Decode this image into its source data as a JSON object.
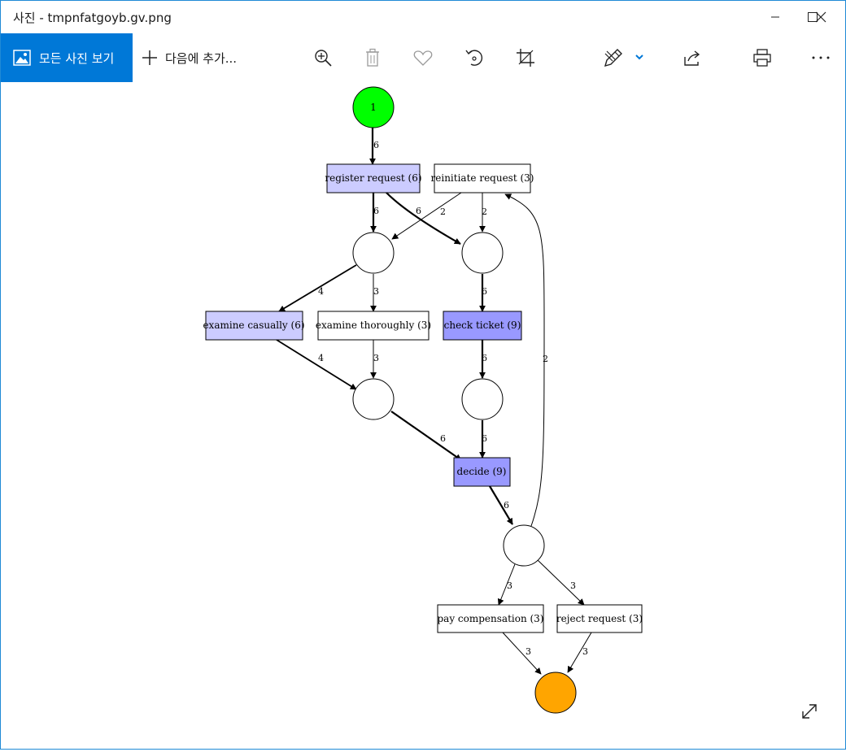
{
  "window": {
    "title": "사진 - tmpnfatgoyb.gv.png",
    "minimize_icon": "minimize-icon",
    "maximize_icon": "maximize-icon",
    "close_icon": "close-icon"
  },
  "toolbar": {
    "all_photos_label": "모든 사진 보기",
    "add_to_label": "다음에 추가...",
    "icons": [
      "zoom-in-icon",
      "delete-icon",
      "favorite-icon",
      "rotate-icon",
      "crop-icon",
      "edit-draw-icon",
      "share-icon",
      "print-icon",
      "more-icon"
    ]
  },
  "graph": {
    "start_node_label": "1",
    "activities": {
      "register_request": "register request (6)",
      "reinitiate_request": "reinitiate request (3)",
      "examine_casually": "examine casually (6)",
      "examine_thoroughly": "examine thoroughly (3)",
      "check_ticket": "check ticket (9)",
      "decide": "decide (9)",
      "pay_compensation": "pay compensation (3)",
      "reject_request": "reject request (3)"
    },
    "edge_labels": {
      "start_to_register": "6",
      "register_to_p1": "6",
      "register_to_p2": "6",
      "reinitiate_to_p1": "2",
      "reinitiate_to_p2": "2",
      "p1_to_casually": "4",
      "p1_to_thoroughly": "3",
      "p2_to_check": "6",
      "casually_to_p3": "4",
      "thoroughly_to_p3": "3",
      "check_to_p4": "6",
      "p3_to_decide": "6",
      "p4_to_decide": "6",
      "decide_to_p5": "6",
      "p5_to_reinitiate": "2",
      "p5_to_pay": "3",
      "p5_to_reject": "3",
      "pay_to_end": "3",
      "reject_to_end": "3"
    },
    "colors": {
      "start": "#00ff00",
      "end": "#ffa500",
      "light_activity": "#ccccff",
      "dark_activity": "#9999ff",
      "plain_activity": "#ffffff"
    }
  },
  "expand_icon": "expand-icon"
}
